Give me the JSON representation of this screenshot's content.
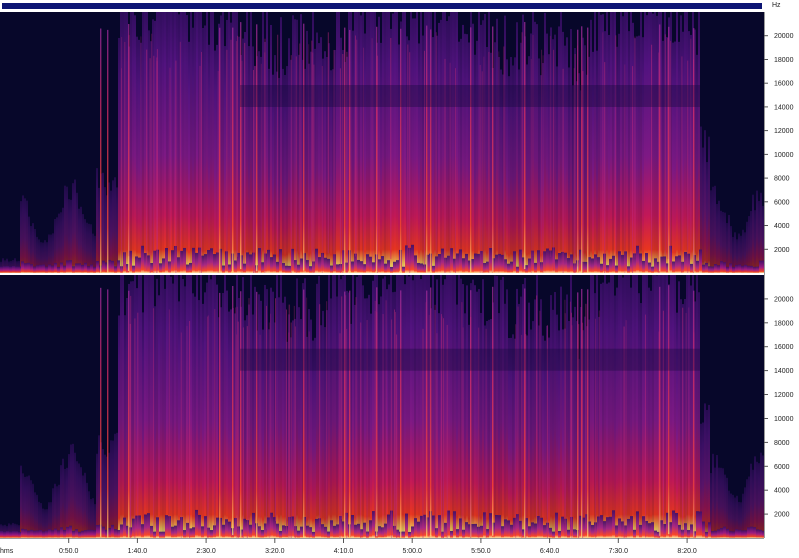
{
  "window": {
    "frequency_unit": "Hz",
    "time_unit": "hms"
  },
  "colors": {
    "background": "#07072a",
    "overview_bar": "#0d1573",
    "low_energy": "#2b0b4f",
    "mid_energy": "#8a1b8e",
    "high_energy": "#ff2a2a",
    "peak_energy": "#ffe37a"
  },
  "chart_data": {
    "type": "heatmap",
    "kind": "spectrogram",
    "channels": [
      "channel-1",
      "channel-2"
    ],
    "frequency_axis": {
      "unit": "Hz",
      "ticks": [
        2000,
        4000,
        6000,
        8000,
        10000,
        12000,
        14000,
        16000,
        18000,
        20000
      ],
      "tick_labels": [
        "2000",
        "4000",
        "6000",
        "8000",
        "10000",
        "12000",
        "14000",
        "16000",
        "18000",
        "20000"
      ],
      "range": [
        0,
        22000
      ]
    },
    "time_axis": {
      "unit": "hms",
      "ticks_seconds": [
        50,
        100,
        150,
        200,
        250,
        300,
        350,
        400,
        450,
        500
      ],
      "tick_labels": [
        "0:50.0",
        "1:40.0",
        "2:30.0",
        "3:20.0",
        "4:10.0",
        "5:00.0",
        "5:50.0",
        "6:40.0",
        "7:30.0",
        "8:20.0"
      ],
      "range_seconds": [
        0,
        556
      ]
    },
    "grid": false
  }
}
